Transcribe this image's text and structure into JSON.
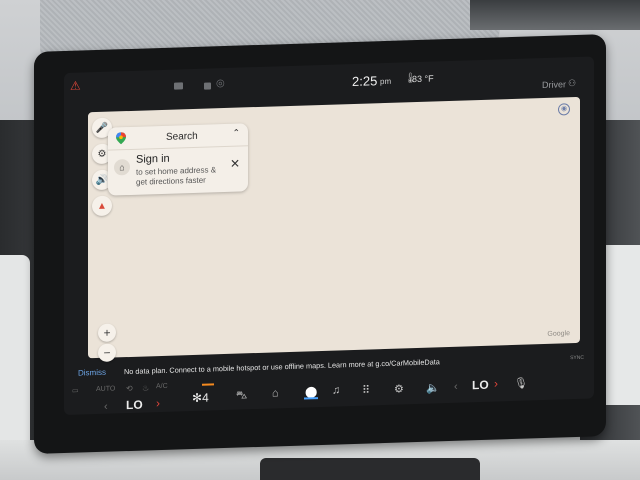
{
  "status_bar": {
    "time": "2:25",
    "ampm": "pm",
    "temperature": "83",
    "temperature_unit": "°F",
    "profile_label": "Driver"
  },
  "map": {
    "attribution": "Google"
  },
  "search_card": {
    "search_label": "Search",
    "sign_in_title": "Sign in",
    "sign_in_line1": "to set home address &",
    "sign_in_line2": "get directions faster"
  },
  "zoom": {
    "in_label": "+",
    "out_label": "−"
  },
  "notification": {
    "dismiss_label": "Dismiss",
    "message": "No data plan. Connect to a mobile hotspot or use offline maps. Learn more at g.co/CarMobileData",
    "sync_label": "SYNC"
  },
  "dock": {
    "auto_label": "AUTO",
    "ac_label": "A/C",
    "left_temp": "LO",
    "fan_speed": "4",
    "right_temp": "LO"
  },
  "colors": {
    "map_bg": "#ebe3d8",
    "dismiss_blue": "#6da6e8",
    "accent_red": "#e2453a",
    "nav_active_blue": "#4aa3ff",
    "fan_orange": "#f58a1f"
  }
}
